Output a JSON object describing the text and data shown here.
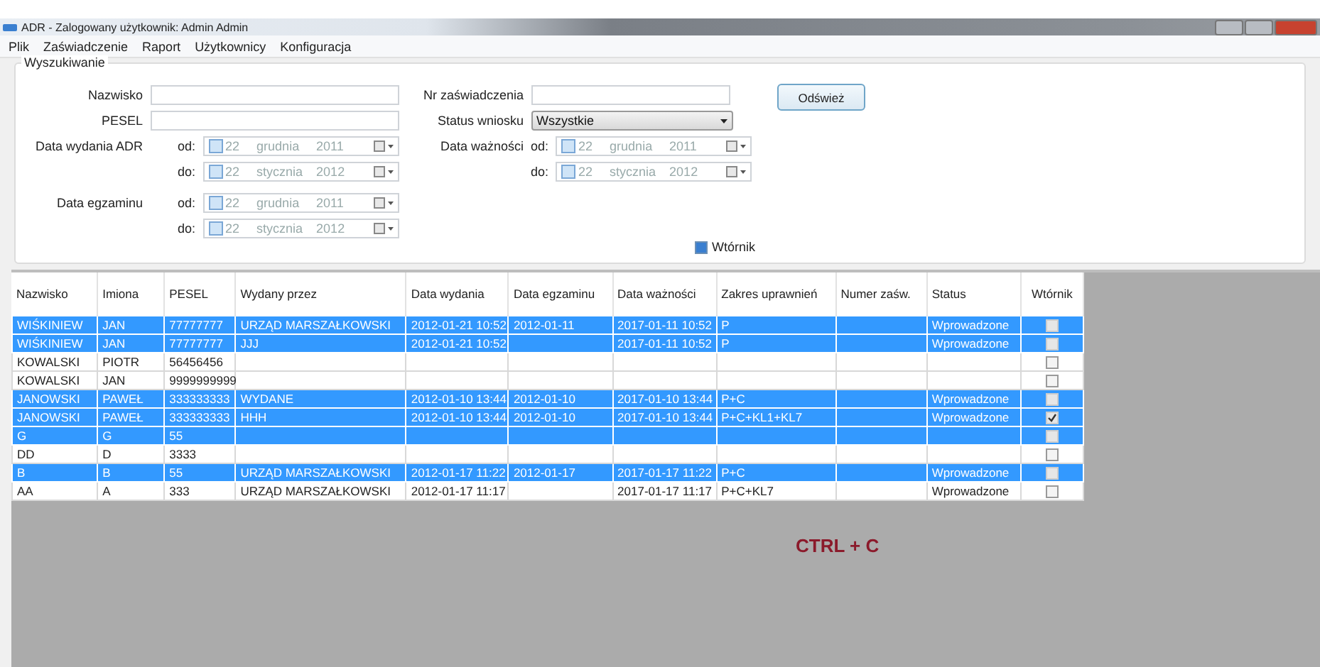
{
  "window": {
    "title": "ADR - Zalogowany użytkownik: Admin Admin"
  },
  "menu": [
    "Plik",
    "Zaświadczenie",
    "Raport",
    "Użytkownicy",
    "Konfiguracja"
  ],
  "search": {
    "title": "Wyszukiwanie",
    "nazwisko": {
      "label": "Nazwisko"
    },
    "pesel": {
      "label": "PESEL"
    },
    "data_wydania": {
      "label": "Data wydania ADR",
      "from_label": "od:",
      "to_label": "do:",
      "from": {
        "checked": false,
        "day": "22",
        "month": "grudnia",
        "year": "2011"
      },
      "to": {
        "checked": false,
        "day": "22",
        "month": "stycznia",
        "year": "2012"
      }
    },
    "data_egzaminu": {
      "label": "Data egzaminu",
      "from_label": "od:",
      "to_label": "do:",
      "from": {
        "checked": false,
        "day": "22",
        "month": "grudnia",
        "year": "2011"
      },
      "to": {
        "checked": false,
        "day": "22",
        "month": "stycznia",
        "year": "2012"
      }
    },
    "nr_zaswiadczenia": {
      "label": "Nr zaświadczenia"
    },
    "status_wniosku": {
      "label": "Status wniosku",
      "value": "Wszystkie"
    },
    "data_waznosci": {
      "label": "Data ważności",
      "from_label": "od:",
      "to_label": "do:",
      "from": {
        "checked": false,
        "day": "22",
        "month": "grudnia",
        "year": "2011"
      },
      "to": {
        "checked": false,
        "day": "22",
        "month": "stycznia",
        "year": "2012"
      }
    },
    "refresh_button": "Odśwież",
    "wtornik": {
      "label": "Wtórnik",
      "checked": true
    }
  },
  "table": {
    "columns": [
      "Nazwisko",
      "Imiona",
      "PESEL",
      "Wydany przez",
      "Data wydania",
      "Data egzaminu",
      "Data ważności",
      "Zakres uprawnień",
      "Numer zaśw.",
      "Status",
      "Wtórnik"
    ],
    "rows": [
      {
        "selected": true,
        "cells": [
          "WIŚKINIEW",
          "JAN",
          "77777777",
          "URZĄD MARSZAŁKOWSKI",
          "2012-01-21 10:52",
          "2012-01-11",
          "2017-01-11 10:52",
          "P",
          "",
          "Wprowadzone"
        ],
        "checked": false
      },
      {
        "selected": true,
        "cells": [
          "WIŚKINIEW",
          "JAN",
          "77777777",
          "JJJ",
          "2012-01-21 10:52",
          "",
          "2017-01-11 10:52",
          "P",
          "",
          "Wprowadzone"
        ],
        "checked": false
      },
      {
        "selected": false,
        "cells": [
          "KOWALSKI",
          "PIOTR",
          "56456456",
          "",
          "",
          "",
          "",
          "",
          "",
          ""
        ],
        "checked": false
      },
      {
        "selected": false,
        "cells": [
          "KOWALSKI",
          "JAN",
          "9999999999",
          "",
          "",
          "",
          "",
          "",
          "",
          ""
        ],
        "checked": false
      },
      {
        "selected": true,
        "cells": [
          "JANOWSKI",
          "PAWEŁ",
          "333333333",
          "WYDANE",
          "2012-01-10 13:44",
          "2012-01-10",
          "2017-01-10 13:44",
          "P+C",
          "",
          "Wprowadzone"
        ],
        "checked": false
      },
      {
        "selected": true,
        "cells": [
          "JANOWSKI",
          "PAWEŁ",
          "333333333",
          "HHH",
          "2012-01-10 13:44",
          "2012-01-10",
          "2017-01-10 13:44",
          "P+C+KL1+KL7",
          "",
          "Wprowadzone"
        ],
        "checked": true
      },
      {
        "selected": true,
        "cells": [
          "G",
          "G",
          "55",
          "",
          "",
          "",
          "",
          "",
          "",
          ""
        ],
        "checked": false
      },
      {
        "selected": false,
        "cells": [
          "DD",
          "D",
          "3333",
          "",
          "",
          "",
          "",
          "",
          "",
          ""
        ],
        "checked": false
      },
      {
        "selected": true,
        "cells": [
          "B",
          "B",
          "55",
          "URZĄD MARSZAŁKOWSKI",
          "2012-01-17 11:22",
          "2012-01-17",
          "2017-01-17 11:22",
          "P+C",
          "",
          "Wprowadzone"
        ],
        "checked": false
      },
      {
        "selected": false,
        "cells": [
          "AA",
          "A",
          "333",
          "URZĄD MARSZAŁKOWSKI",
          "2012-01-17 11:17",
          "",
          "2017-01-17 11:17",
          "P+C+KL7",
          "",
          "Wprowadzone"
        ],
        "checked": false
      }
    ]
  },
  "overlay_text": "CTRL + C"
}
